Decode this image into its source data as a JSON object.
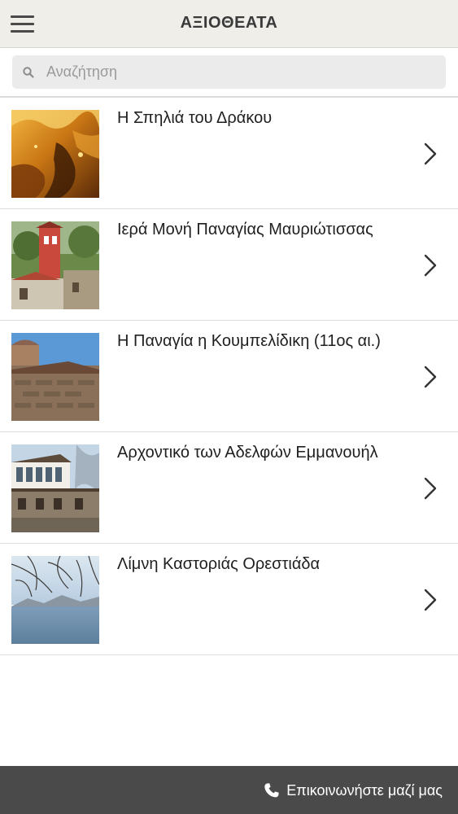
{
  "header": {
    "title": "ΑΞΙΟΘΕΑΤΑ",
    "menu_icon": "hamburger-menu-icon"
  },
  "search": {
    "placeholder": "Αναζήτηση",
    "value": "",
    "icon": "search-icon"
  },
  "items": [
    {
      "label": "Η Σπηλιά του Δράκου",
      "thumb": "cave-photo"
    },
    {
      "label": "Ιερά Μονή Παναγίας Μαυριώτισσας",
      "thumb": "monastery-bell-tower-photo"
    },
    {
      "label": "Η Παναγία η Κουμπελίδικη (11ος αι.)",
      "thumb": "byzantine-church-photo"
    },
    {
      "label": "Αρχοντικό των Αδελφών Εμμανουήλ",
      "thumb": "mansion-photo"
    },
    {
      "label": "Λίμνη Καστοριάς Ορεστιάδα",
      "thumb": "lake-photo"
    }
  ],
  "footer": {
    "contact_label": "Επικοινωνήστε μαζί μας",
    "icon": "phone-icon"
  },
  "colors": {
    "header_bg": "#efeee9",
    "footer_bg": "#4a4a4a",
    "search_bg": "#ebebeb"
  }
}
